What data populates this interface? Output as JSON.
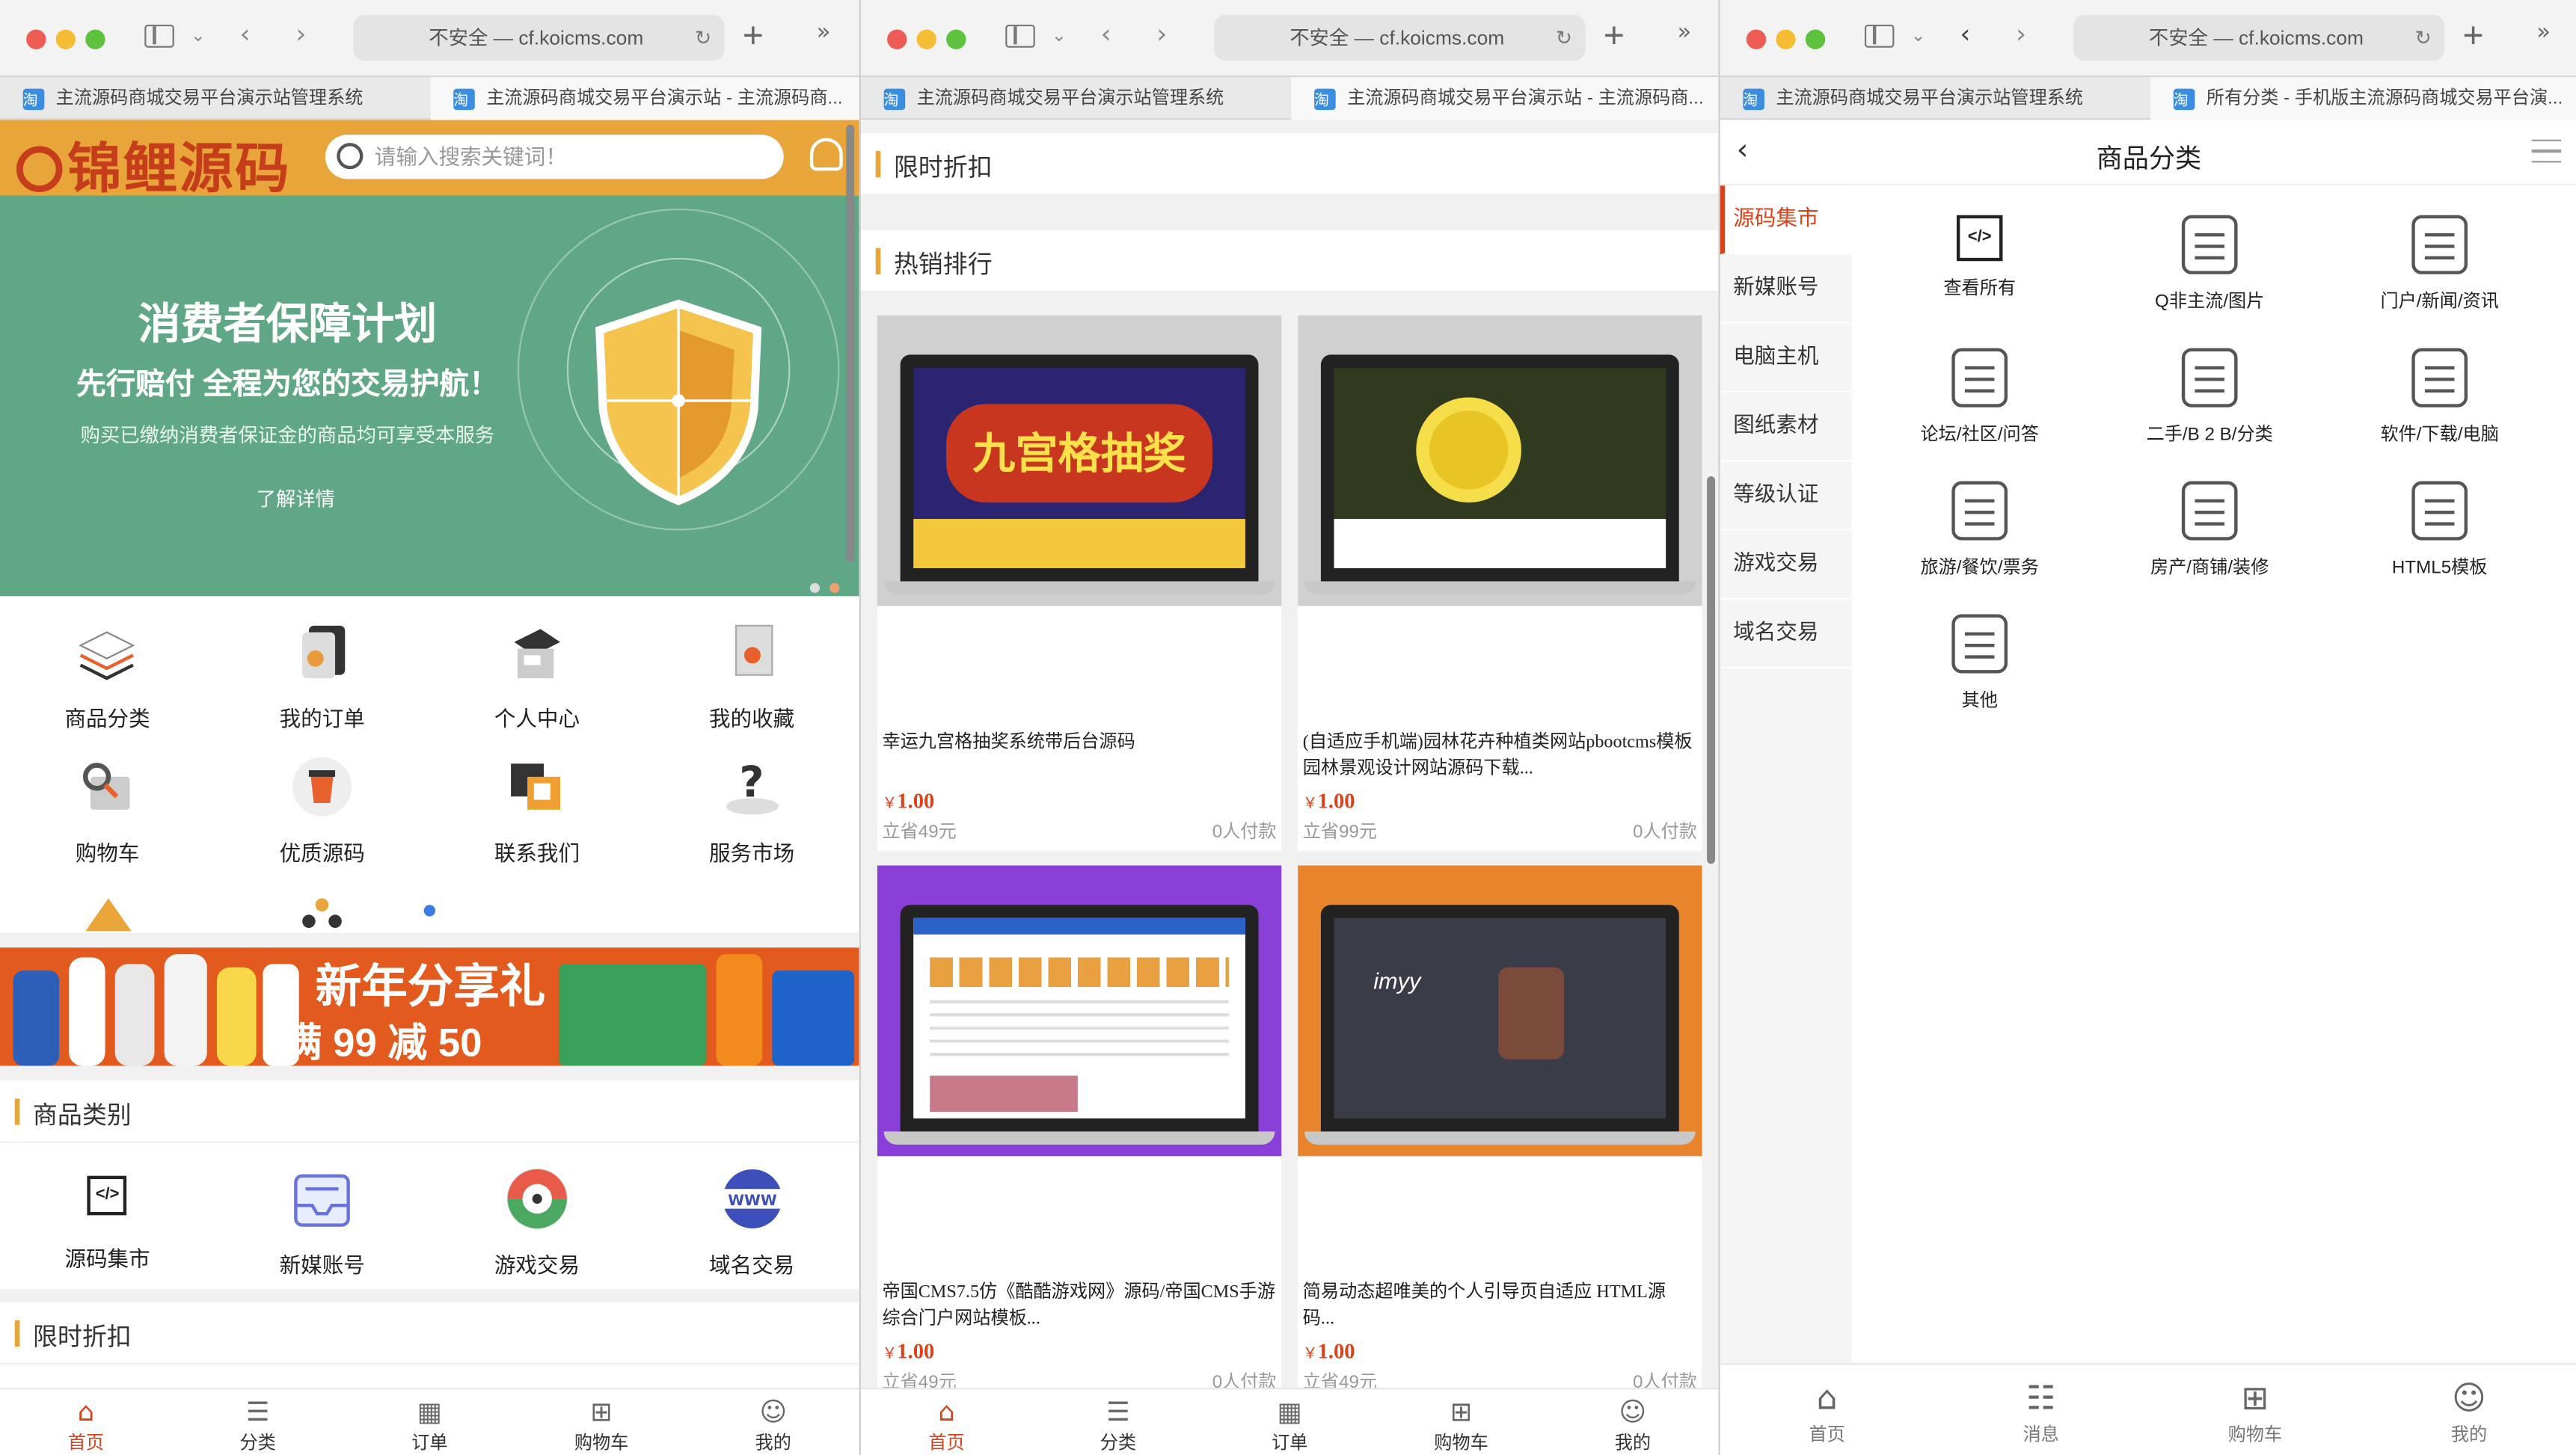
{
  "browser": {
    "address": "不安全 — cf.koicms.com",
    "tabs_w1": [
      "主流源码商城交易平台演示站管理系统",
      "主流源码商城交易平台演示站 - 主流源码商..."
    ],
    "tabs_w3": [
      "主流源码商城交易平台演示站管理系统",
      "所有分类 - 手机版主流源码商城交易平台演..."
    ]
  },
  "home": {
    "logo": "锦鲤源码",
    "search_placeholder": "请输入搜索关键词！",
    "hero": {
      "title": "消费者保障计划",
      "subtitle": "先行赔付 全程为您的交易护航！",
      "desc": "购买已缴纳消费者保证金的商品均可享受本服务",
      "link": "了解详情"
    },
    "menu": [
      "商品分类",
      "我的订单",
      "个人中心",
      "我的收藏",
      "购物车",
      "优质源码",
      "联系我们",
      "服务市场"
    ],
    "promo": {
      "line1": "新年分享礼",
      "line2": "满 99 减 50"
    },
    "section_category": "商品类别",
    "categories": [
      "源码集市",
      "新媒账号",
      "游戏交易",
      "域名交易"
    ],
    "section_discount": "限时折扣",
    "www": "WWW"
  },
  "list": {
    "section_discount": "限时折扣",
    "section_hot": "热销排行",
    "products": [
      {
        "name": "幸运九宫格抽奖系统带后台源码",
        "price": "1.00",
        "save": "立省49元",
        "buyers": "0人付款",
        "screen_text": "九宫格抽奖"
      },
      {
        "name": "(自适应手机端)园林花卉种植类网站pbootcms模板 园林景观设计网站源码下载...",
        "price": "1.00",
        "save": "立省99元",
        "buyers": "0人付款",
        "screen_text": ""
      },
      {
        "name": "帝国CMS7.5仿《酷酷游戏网》源码/帝国CMS手游综合门户网站模板...",
        "price": "1.00",
        "save": "立省49元",
        "buyers": "0人付款",
        "screen_text": ""
      },
      {
        "name": "简易动态超唯美的个人引导页自适应 HTML源码...",
        "price": "1.00",
        "save": "立省49元",
        "buyers": "0人付款",
        "screen_text": "imyy"
      }
    ],
    "currency": "￥"
  },
  "category_page": {
    "title": "商品分类",
    "sidebar": [
      "源码集市",
      "新媒账号",
      "电脑主机",
      "图纸素材",
      "等级认证",
      "游戏交易",
      "域名交易"
    ],
    "items": [
      "查看所有",
      "Q非主流/图片",
      "门户/新闻/资讯",
      "论坛/社区/问答",
      "二手/B 2 B/分类",
      "软件/下载/电脑",
      "旅游/餐饮/票务",
      "房产/商铺/装修",
      "HTML5模板",
      "其他"
    ]
  },
  "bottom_nav_main": [
    "首页",
    "分类",
    "订单",
    "购物车",
    "我的"
  ],
  "bottom_nav_cat": [
    "首页",
    "消息",
    "购物车",
    "我的"
  ],
  "colors": {
    "accent": "#d9421a",
    "header": "#e8a53a",
    "hero": "#5fa786"
  }
}
